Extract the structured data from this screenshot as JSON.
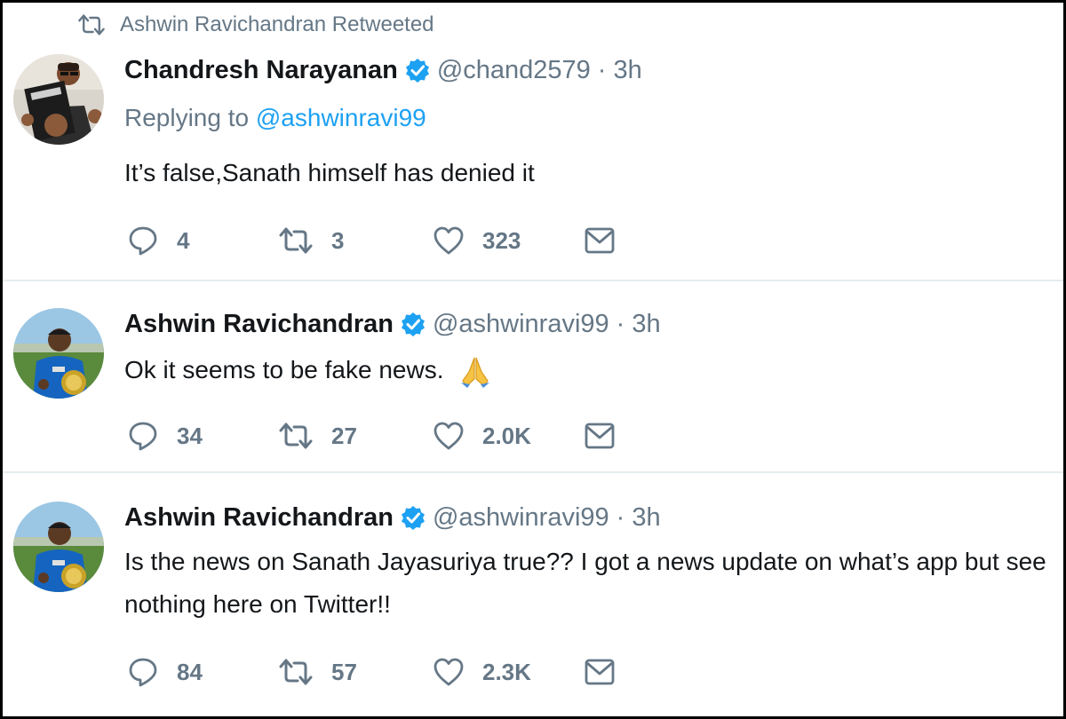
{
  "retweet_banner": {
    "icon": "retweet-icon",
    "text": "Ashwin Ravichandran Retweeted"
  },
  "tweets": [
    {
      "avatar": "avatar-chandresh",
      "name": "Chandresh Narayanan",
      "verified": true,
      "handle": "@chand2579",
      "separator": "·",
      "time": "3h",
      "replying_prefix": "Replying to",
      "replying_to": "@ashwinravi99",
      "text": "It’s false,Sanath himself has denied it",
      "emoji": "",
      "replies": "4",
      "retweets": "3",
      "likes": "323"
    },
    {
      "avatar": "avatar-ashwin",
      "name": "Ashwin Ravichandran",
      "verified": true,
      "handle": "@ashwinravi99",
      "separator": "·",
      "time": "3h",
      "text": "Ok it seems to be fake news.",
      "emoji": "folded-hands-icon",
      "replies": "34",
      "retweets": "27",
      "likes": "2.0K"
    },
    {
      "avatar": "avatar-ashwin",
      "name": "Ashwin Ravichandran",
      "verified": true,
      "handle": "@ashwinravi99",
      "separator": "·",
      "time": "3h",
      "text": "Is the news on Sanath Jayasuriya true?? I got a news update on what’s app but see nothing here on Twitter!!",
      "emoji": "",
      "replies": "84",
      "retweets": "57",
      "likes": "2.3K"
    }
  ],
  "colors": {
    "text_primary": "#14171a",
    "text_secondary": "#657786",
    "link": "#1da1f2",
    "verified": "#1da1f2",
    "divider": "#e6ecf0",
    "frame_border": "#000000"
  },
  "icons": {
    "reply": "reply-icon",
    "retweet": "retweet-icon",
    "like": "heart-icon",
    "dm": "envelope-icon",
    "verified": "verified-badge-icon"
  }
}
